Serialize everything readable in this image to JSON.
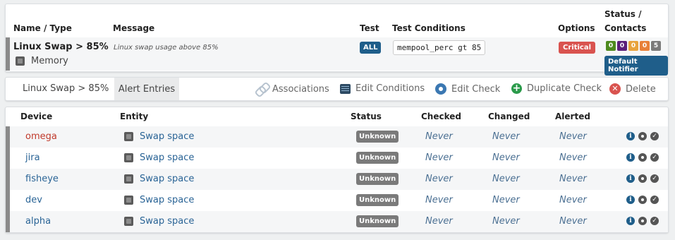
{
  "top_table": {
    "headers": {
      "name_type": "Name / Type",
      "message": "Message",
      "test": "Test",
      "test_conditions": "Test Conditions",
      "options": "Options",
      "status_line1": "Status /",
      "status_line2": "Contacts"
    },
    "row": {
      "name": "Linux Swap > 85%",
      "type": "Memory",
      "message": "Linux swap usage above 85%",
      "test": "ALL",
      "condition": "mempool_perc gt 85",
      "option": "Critical",
      "counts": [
        {
          "value": "0",
          "color": "#4e8a1e"
        },
        {
          "value": "0",
          "color": "#5b1f7a"
        },
        {
          "value": "0",
          "color": "#e8a33d"
        },
        {
          "value": "0",
          "color": "#e8803a"
        },
        {
          "value": "5",
          "color": "#7a7a7a"
        }
      ],
      "contact": "Default Notifier"
    }
  },
  "toolbar": {
    "title": "Linux Swap > 85%",
    "tab": "Alert Entries",
    "associations": "Associations",
    "edit_conditions": "Edit Conditions",
    "edit_check": "Edit Check",
    "duplicate_check": "Duplicate Check",
    "delete": "Delete"
  },
  "entries": {
    "headers": {
      "device": "Device",
      "entity": "Entity",
      "status": "Status",
      "checked": "Checked",
      "changed": "Changed",
      "alerted": "Alerted"
    },
    "rows": [
      {
        "device": "omega",
        "device_color": "#c0392b",
        "entity": "Swap space",
        "status": "Unknown",
        "checked": "Never",
        "changed": "Never",
        "alerted": "Never"
      },
      {
        "device": "jira",
        "device_color": "#2a6496",
        "entity": "Swap space",
        "status": "Unknown",
        "checked": "Never",
        "changed": "Never",
        "alerted": "Never"
      },
      {
        "device": "fisheye",
        "device_color": "#2a6496",
        "entity": "Swap space",
        "status": "Unknown",
        "checked": "Never",
        "changed": "Never",
        "alerted": "Never"
      },
      {
        "device": "dev",
        "device_color": "#2a6496",
        "entity": "Swap space",
        "status": "Unknown",
        "checked": "Never",
        "changed": "Never",
        "alerted": "Never"
      },
      {
        "device": "alpha",
        "device_color": "#2a6496",
        "entity": "Swap space",
        "status": "Unknown",
        "checked": "Never",
        "changed": "Never",
        "alerted": "Never"
      }
    ]
  }
}
